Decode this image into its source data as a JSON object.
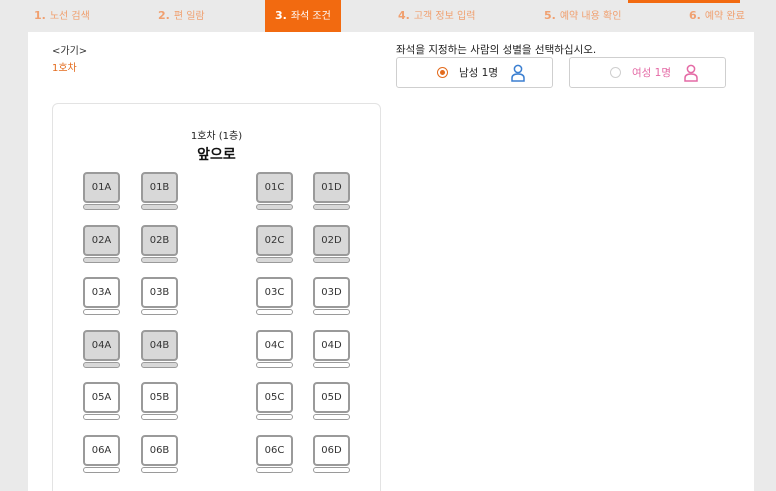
{
  "steps": [
    {
      "num": "1.",
      "label": "노선 검색"
    },
    {
      "num": "2.",
      "label": "편 일람"
    },
    {
      "num": "3.",
      "label": "좌석 조건"
    },
    {
      "num": "4.",
      "label": "고객 정보 입력"
    },
    {
      "num": "5.",
      "label": "예약 내용 확인"
    },
    {
      "num": "6.",
      "label": "예약 완료"
    }
  ],
  "nav": {
    "back": "<가기>",
    "car": "1호차"
  },
  "gender": {
    "instruction": "좌석을 지정하는 사람의 성별을 선택하십시오.",
    "male": "남성 1명",
    "female": "여성 1명",
    "selected": "male",
    "male_color": "#3b7fd1",
    "female_color": "#e46aa5"
  },
  "seatmap": {
    "car_title": "1호차 (1층)",
    "front": "앞으로",
    "rows": [
      {
        "seats": [
          {
            "id": "01A",
            "taken": true
          },
          {
            "id": "01B",
            "taken": true
          },
          {
            "id": "01C",
            "taken": true
          },
          {
            "id": "01D",
            "taken": true
          }
        ]
      },
      {
        "seats": [
          {
            "id": "02A",
            "taken": true
          },
          {
            "id": "02B",
            "taken": true
          },
          {
            "id": "02C",
            "taken": true
          },
          {
            "id": "02D",
            "taken": true
          }
        ]
      },
      {
        "seats": [
          {
            "id": "03A",
            "taken": false
          },
          {
            "id": "03B",
            "taken": false
          },
          {
            "id": "03C",
            "taken": false
          },
          {
            "id": "03D",
            "taken": false
          }
        ]
      },
      {
        "seats": [
          {
            "id": "04A",
            "taken": true
          },
          {
            "id": "04B",
            "taken": true
          },
          {
            "id": "04C",
            "taken": false
          },
          {
            "id": "04D",
            "taken": false
          }
        ]
      },
      {
        "seats": [
          {
            "id": "05A",
            "taken": false
          },
          {
            "id": "05B",
            "taken": false
          },
          {
            "id": "05C",
            "taken": false
          },
          {
            "id": "05D",
            "taken": false
          }
        ]
      },
      {
        "seats": [
          {
            "id": "06A",
            "taken": false
          },
          {
            "id": "06B",
            "taken": false
          },
          {
            "id": "06C",
            "taken": false
          },
          {
            "id": "06D",
            "taken": false
          }
        ]
      }
    ]
  },
  "colors": {
    "accent": "#f26a10",
    "link": "#e36b1d"
  }
}
